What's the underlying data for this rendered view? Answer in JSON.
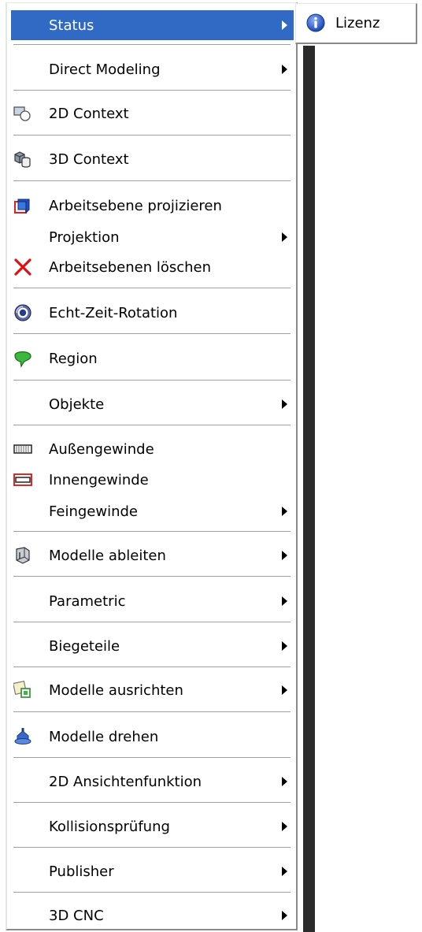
{
  "menu": {
    "items": [
      {
        "label": "Status",
        "icon": null,
        "submenu": true,
        "selected": true
      },
      {
        "label": "Direct Modeling",
        "icon": null,
        "submenu": true
      },
      {
        "label": "2D Context",
        "icon": "2d-context-icon",
        "submenu": false
      },
      {
        "label": "3D Context",
        "icon": "3d-context-icon",
        "submenu": false
      },
      {
        "label": "Arbeitsebene projizieren",
        "icon": "project-workplane-icon",
        "submenu": false
      },
      {
        "label": "Projektion",
        "icon": null,
        "submenu": true
      },
      {
        "label": "Arbeitsebenen löschen",
        "icon": "delete-x-icon",
        "submenu": false
      },
      {
        "label": "Echt-Zeit-Rotation",
        "icon": "realtime-rotation-icon",
        "submenu": false
      },
      {
        "label": "Region",
        "icon": "region-icon",
        "submenu": false
      },
      {
        "label": "Objekte",
        "icon": null,
        "submenu": true
      },
      {
        "label": "Außengewinde",
        "icon": "external-thread-icon",
        "submenu": false
      },
      {
        "label": "Innengewinde",
        "icon": "internal-thread-icon",
        "submenu": false
      },
      {
        "label": "Feingewinde",
        "icon": null,
        "submenu": true
      },
      {
        "label": "Modelle ableiten",
        "icon": "derive-models-icon",
        "submenu": true
      },
      {
        "label": "Parametric",
        "icon": null,
        "submenu": true
      },
      {
        "label": "Biegeteile",
        "icon": null,
        "submenu": true
      },
      {
        "label": "Modelle ausrichten",
        "icon": "align-models-icon",
        "submenu": true
      },
      {
        "label": "Modelle drehen",
        "icon": "rotate-models-icon",
        "submenu": false
      },
      {
        "label": "2D Ansichtenfunktion",
        "icon": null,
        "submenu": true
      },
      {
        "label": "Kollisionsprüfung",
        "icon": null,
        "submenu": true
      },
      {
        "label": "Publisher",
        "icon": null,
        "submenu": true
      },
      {
        "label": "3D CNC",
        "icon": null,
        "submenu": true
      }
    ]
  },
  "submenu": {
    "items": [
      {
        "label": "Lizenz",
        "icon": "info-icon"
      }
    ]
  },
  "colors": {
    "selection": "#316ac5",
    "selection_text": "#ffffff",
    "text": "#000000"
  }
}
